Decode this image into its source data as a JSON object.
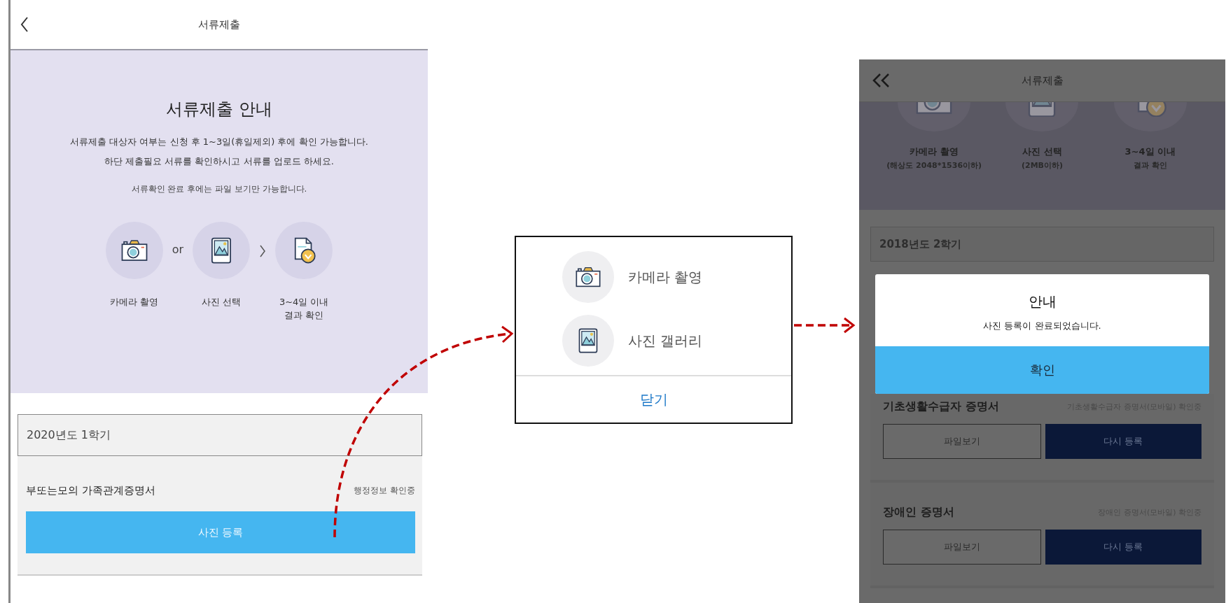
{
  "left_screen": {
    "title": "서류제출",
    "guide": {
      "heading": "서류제출 안내",
      "lines": [
        "서류제출 대상자 여부는 신청 후 1~3일(휴일제외) 후에 확인 가능합니다.",
        "하단 제출필요 서류를 확인하시고 서류를 업로드 하세요."
      ],
      "note": "서류확인 완료 후에는 파일 보기만 가능합니다."
    },
    "steps": [
      {
        "kind": "camera",
        "lines": [
          "카메라 촬영"
        ]
      },
      {
        "kind": "gallery",
        "lines": [
          "사진 선택"
        ]
      },
      {
        "kind": "result",
        "lines": [
          "3~4일 이내",
          "결과 확인"
        ]
      }
    ],
    "step_joiner": "or",
    "semester": "2020년도 1학기",
    "documents": [
      {
        "name": "부또는모의 가족관계증명서",
        "status": "행정정보 확인중",
        "button": "사진 등록"
      }
    ]
  },
  "popup": {
    "options": [
      {
        "kind": "camera",
        "label": "카메라 촬영"
      },
      {
        "kind": "gallery",
        "label": "사진 갤러리"
      }
    ],
    "close": "닫기"
  },
  "right_screen": {
    "title": "서류제출",
    "steps": [
      {
        "kind": "camera",
        "label": "카메라 촬영",
        "sub": "(해상도 2048*1536이하)"
      },
      {
        "kind": "gallery",
        "label": "사진 선택",
        "sub": "(2MB이하)"
      },
      {
        "kind": "result",
        "label": "3~4일 이내",
        "sub": "결과 확인"
      }
    ],
    "semester": "2018년도 2학기",
    "dialog": {
      "title": "안내",
      "message": "사진 등록이 완료되었습니다.",
      "confirm": "확인"
    },
    "documents": [
      {
        "name": "기초생활수급자 증명서",
        "status": "기초생활수급자 증명서(모바일) 확인중",
        "buttons": [
          "파일보기",
          "다시 등록"
        ]
      },
      {
        "name": "장애인 증명서",
        "status": "장애인 증명서(모바일) 확인중",
        "buttons": [
          "파일보기",
          "다시 등록"
        ]
      }
    ]
  }
}
